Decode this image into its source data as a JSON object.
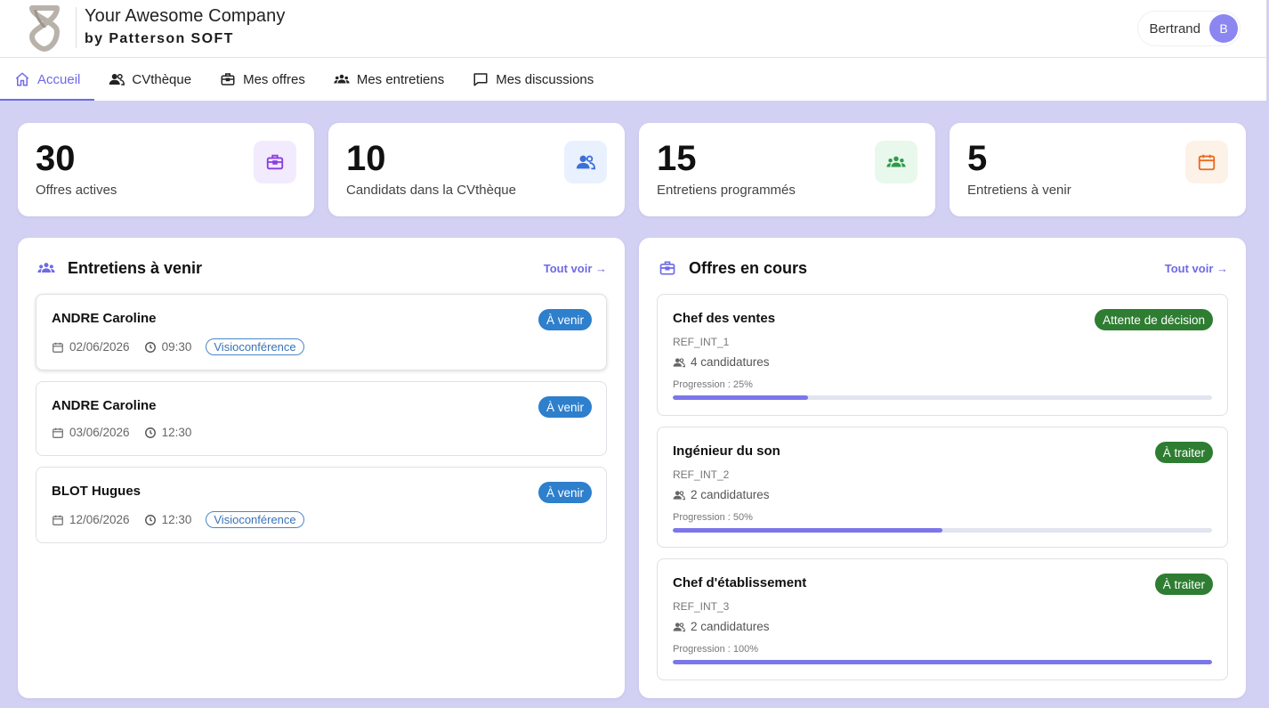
{
  "header": {
    "company": "Your Awesome Company",
    "subtitle": "by Patterson SOFT",
    "user_name": "Bertrand",
    "avatar_initial": "B"
  },
  "nav": [
    {
      "label": "Accueil",
      "icon": "home-icon",
      "active": true
    },
    {
      "label": "CVthèque",
      "icon": "users-icon",
      "active": false
    },
    {
      "label": "Mes offres",
      "icon": "briefcase-icon",
      "active": false
    },
    {
      "label": "Mes entretiens",
      "icon": "group-icon",
      "active": false
    },
    {
      "label": "Mes discussions",
      "icon": "chat-icon",
      "active": false
    }
  ],
  "stats": [
    {
      "value": "30",
      "label": "Offres actives",
      "icon": "briefcase-icon",
      "color": "#8a3ee0",
      "bg": "#f2eafd"
    },
    {
      "value": "10",
      "label": "Candidats dans la CVthèque",
      "icon": "users-icon",
      "color": "#3d6fd8",
      "bg": "#e9f1fe"
    },
    {
      "value": "15",
      "label": "Entretiens programmés",
      "icon": "group-icon",
      "color": "#2f9a4a",
      "bg": "#e8f8ec"
    },
    {
      "value": "5",
      "label": "Entretiens à venir",
      "icon": "calendar-icon",
      "color": "#ea6a1f",
      "bg": "#fdf2e8"
    }
  ],
  "interviews": {
    "title": "Entretiens à venir",
    "see_all": "Tout voir →",
    "items": [
      {
        "name": "ANDRE Caroline",
        "status": "À venir",
        "date": "02/06/2026",
        "time": "09:30",
        "mode": "Visioconférence"
      },
      {
        "name": "ANDRE Caroline",
        "status": "À venir",
        "date": "03/06/2026",
        "time": "12:30",
        "mode": ""
      },
      {
        "name": "BLOT Hugues",
        "status": "À venir",
        "date": "12/06/2026",
        "time": "12:30",
        "mode": "Visioconférence"
      }
    ]
  },
  "offers": {
    "title": "Offres en cours",
    "see_all": "Tout voir →",
    "items": [
      {
        "title": "Chef des ventes",
        "status": "Attente de décision",
        "ref": "REF_INT_1",
        "candidates": "4 candidatures",
        "progress_label": "Progression : 25%",
        "progress": 25
      },
      {
        "title": "Ingénieur du son",
        "status": "À traiter",
        "ref": "REF_INT_2",
        "candidates": "2 candidatures",
        "progress_label": "Progression : 50%",
        "progress": 50
      },
      {
        "title": "Chef d'établissement",
        "status": "À traiter",
        "ref": "REF_INT_3",
        "candidates": "2 candidatures",
        "progress_label": "Progression : 100%",
        "progress": 100
      }
    ]
  }
}
